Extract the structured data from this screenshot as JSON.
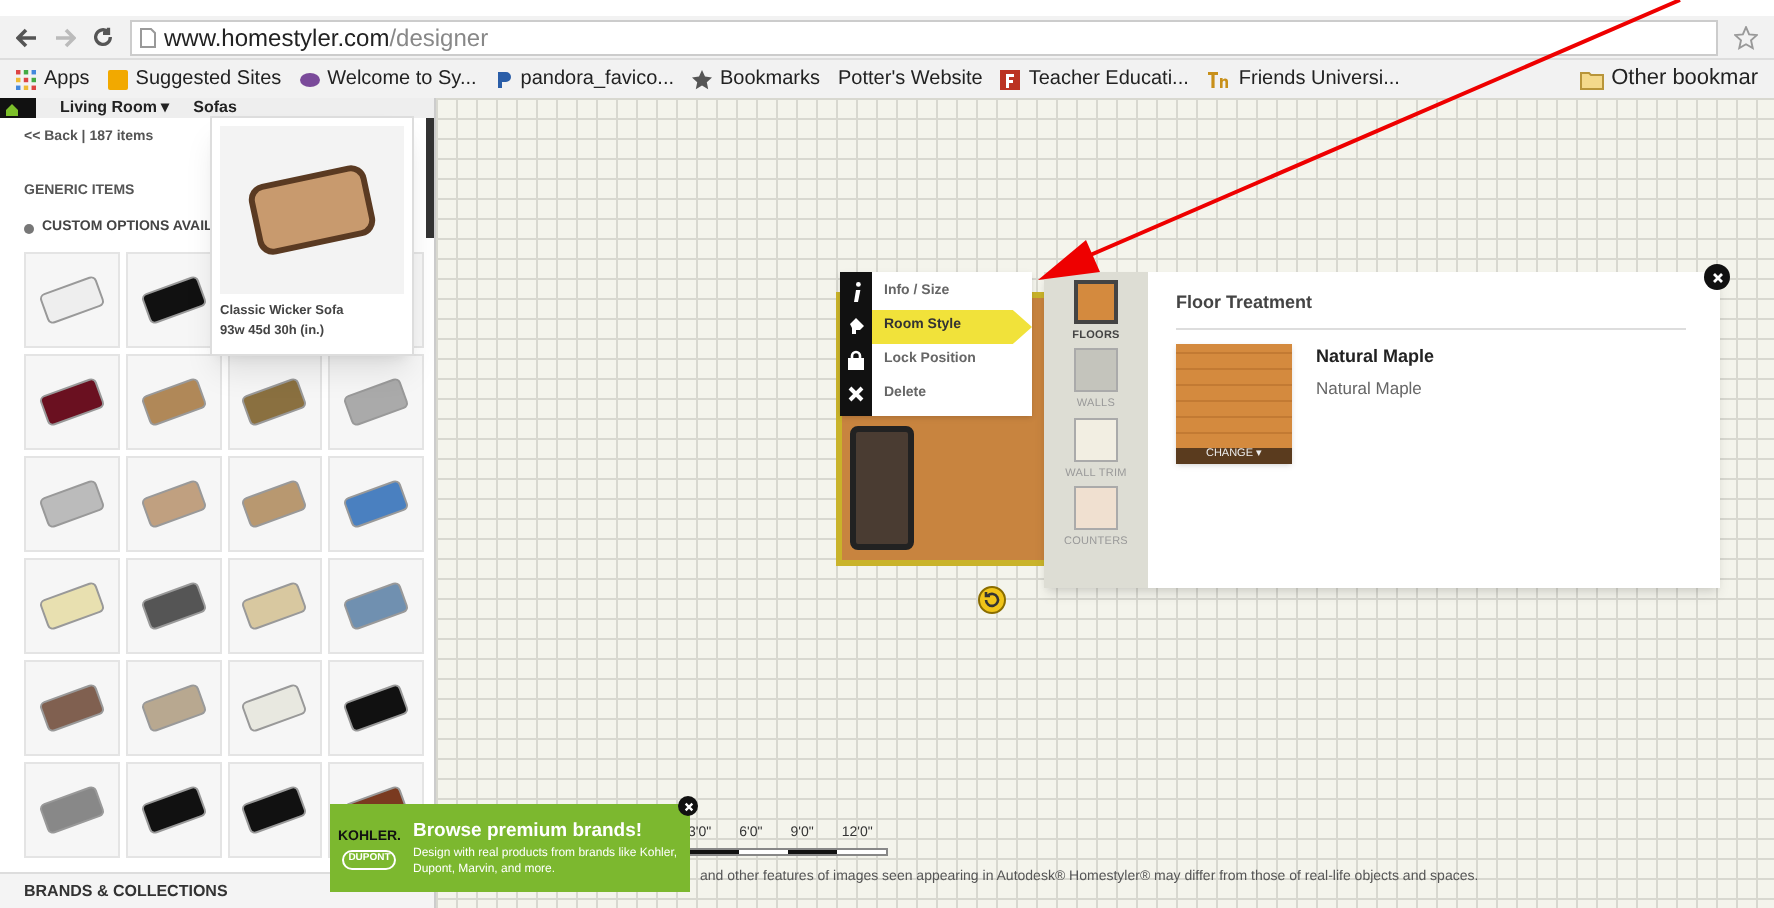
{
  "browser": {
    "url_host": "www.homestyler.com",
    "url_path": "/designer",
    "bookmarks": [
      {
        "label": "Apps",
        "kind": "apps"
      },
      {
        "label": "Suggested Sites",
        "kind": "orange"
      },
      {
        "label": "Welcome to Sy...",
        "kind": "purple"
      },
      {
        "label": "pandora_favico...",
        "kind": "p"
      },
      {
        "label": "Bookmarks",
        "kind": "star"
      },
      {
        "label": "Potter's Website",
        "kind": "none"
      },
      {
        "label": "Teacher Educati...",
        "kind": "red"
      },
      {
        "label": "Friends Universi...",
        "kind": "tn"
      }
    ],
    "other_bookmarks": "Other bookmar"
  },
  "breadcrumb": {
    "room": "Living Room ▾",
    "category": "Sofas"
  },
  "catalog": {
    "back": "<< Back | 187 items",
    "section": "GENERIC ITEMS",
    "custom_options": "CUSTOM OPTIONS AVAIL",
    "footer": "BRANDS & COLLECTIONS",
    "tooltip": {
      "name": "Classic Wicker Sofa",
      "dimensions": "93w 45d 30h (in.)"
    }
  },
  "context_menu": [
    {
      "label": "Info / Size",
      "kind": "info",
      "selected": false
    },
    {
      "label": "Room Style",
      "kind": "style",
      "selected": true
    },
    {
      "label": "Lock Position",
      "kind": "lock",
      "selected": false
    },
    {
      "label": "Delete",
      "kind": "delete",
      "selected": false
    }
  ],
  "style_panel": {
    "tabs": [
      {
        "label": "FLOORS",
        "kind": "floor",
        "selected": true
      },
      {
        "label": "WALLS",
        "kind": "wall",
        "selected": false
      },
      {
        "label": "WALL TRIM",
        "kind": "trim",
        "selected": false
      },
      {
        "label": "COUNTERS",
        "kind": "counter",
        "selected": false
      }
    ],
    "title": "Floor Treatment",
    "material_name": "Natural Maple",
    "material_subtitle": "Natural Maple",
    "change_button": "CHANGE ▾"
  },
  "scale": [
    "3'0\"",
    "6'0\"",
    "9'0\"",
    "12'0\""
  ],
  "promo": {
    "logos": [
      "KOHLER.",
      "DUPONT"
    ],
    "title": "Browse premium brands!",
    "body": "Design with real products from brands like Kohler, Dupont, Marvin, and more."
  },
  "disclaimer": "and other features of images seen appearing in Autodesk® Homestyler® may differ from those of real-life objects and spaces."
}
